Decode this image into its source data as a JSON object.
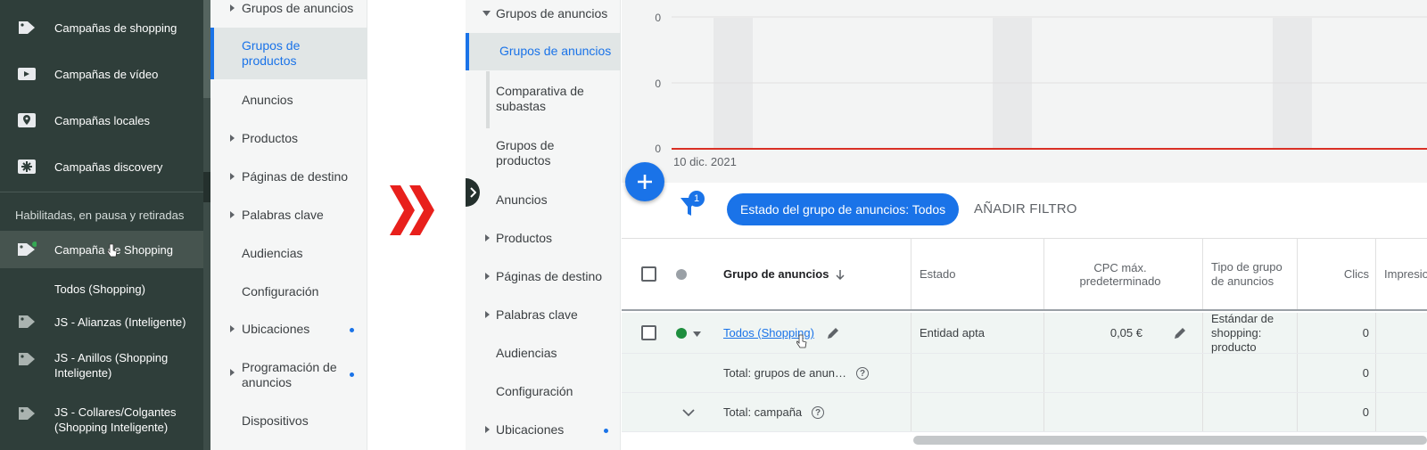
{
  "sidebar": {
    "items": [
      {
        "label": "Campañas de shopping",
        "icon": "tag-icon"
      },
      {
        "label": "Campañas de vídeo",
        "icon": "video-icon"
      },
      {
        "label": "Campañas locales",
        "icon": "map-pin-icon"
      },
      {
        "label": "Campañas discovery",
        "icon": "asterisk-icon"
      }
    ],
    "section_label": "Habilitadas, en pausa y retiradas",
    "campaigns": [
      {
        "label": "Campaña de Shopping",
        "selected": true
      },
      {
        "label": "Todos (Shopping)"
      },
      {
        "label": "JS - Alianzas (Inteligente)"
      },
      {
        "label": "JS - Anillos (Shopping Inteligente)"
      },
      {
        "label": "JS - Collares/Colgantes (Shopping Inteligente)"
      }
    ]
  },
  "menu_left": [
    {
      "label": "Grupos de anuncios",
      "caret": true
    },
    {
      "label": "Grupos de productos",
      "active": true
    },
    {
      "label": "Anuncios"
    },
    {
      "label": "Productos",
      "caret": true
    },
    {
      "label": "Páginas de destino",
      "caret": true
    },
    {
      "label": "Palabras clave",
      "caret": true
    },
    {
      "label": "Audiencias"
    },
    {
      "label": "Configuración"
    },
    {
      "label": "Ubicaciones",
      "caret": true,
      "dot": true
    },
    {
      "label": "Programación de anuncios",
      "caret": true,
      "dot": true
    },
    {
      "label": "Dispositivos"
    }
  ],
  "menu_right": [
    {
      "label": "Grupos de anuncios",
      "caret": "down"
    },
    {
      "label": "Grupos de anuncios",
      "active": true
    },
    {
      "label": "Comparativa de subastas"
    },
    {
      "label": "Grupos de productos"
    },
    {
      "label": "Anuncios"
    },
    {
      "label": "Productos",
      "caret": true
    },
    {
      "label": "Páginas de destino",
      "caret": true
    },
    {
      "label": "Palabras clave",
      "caret": true
    },
    {
      "label": "Audiencias"
    },
    {
      "label": "Configuración"
    },
    {
      "label": "Ubicaciones",
      "caret": true,
      "dot": true
    }
  ],
  "chart": {
    "y_ticks": [
      "0",
      "0",
      "0"
    ],
    "x_label": "10 dic. 2021",
    "line_color": "#d93025"
  },
  "filter": {
    "badge": "1",
    "chip": "Estado del grupo de anuncios: Todos",
    "add_filter": "AÑADIR FILTRO"
  },
  "table": {
    "headers": {
      "group": "Grupo de anuncios",
      "status": "Estado",
      "cpc": "CPC máx. predeterminado",
      "type": "Tipo de grupo de anuncios",
      "clicks": "Clics",
      "impressions": "Impresio"
    },
    "rows": [
      {
        "group": "Todos (Shopping)",
        "status": "Entidad apta",
        "cpc": "0,05 €",
        "type": "Estándar de shopping: producto",
        "clicks": "0"
      }
    ],
    "totals": [
      {
        "label": "Total: grupos de anun…",
        "clicks": "0"
      },
      {
        "label": "Total: campaña",
        "clicks": "0"
      }
    ]
  },
  "colors": {
    "accent": "#1a73e8",
    "status_enabled": "#1e8e3e",
    "arrow_red": "#e8201c"
  }
}
